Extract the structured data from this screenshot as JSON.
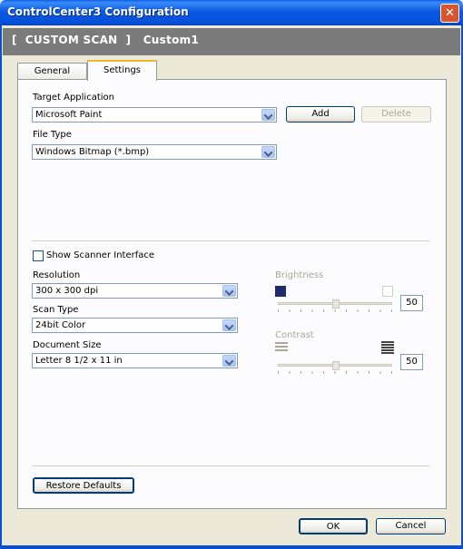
{
  "window": {
    "title": "ControlCenter3 Configuration",
    "close_glyph": "✕"
  },
  "header": {
    "text": "[  CUSTOM SCAN  ]   Custom1"
  },
  "tabs": [
    {
      "label": "General"
    },
    {
      "label": "Settings"
    }
  ],
  "target_app": {
    "label": "Target Application",
    "value": "Microsoft Paint",
    "add_label": "Add",
    "delete_label": "Delete"
  },
  "file_type": {
    "label": "File Type",
    "value": "Windows Bitmap (*.bmp)"
  },
  "show_scanner": {
    "label": "Show Scanner Interface",
    "checked": false
  },
  "resolution": {
    "label": "Resolution",
    "value": "300 x 300 dpi"
  },
  "scan_type": {
    "label": "Scan Type",
    "value": "24bit Color"
  },
  "document_size": {
    "label": "Document Size",
    "value": "Letter 8 1/2 x 11 in"
  },
  "brightness": {
    "label": "Brightness",
    "value": "50"
  },
  "contrast": {
    "label": "Contrast",
    "value": "50"
  },
  "buttons": {
    "restore": "Restore Defaults",
    "ok": "OK",
    "cancel": "Cancel"
  },
  "colors": {
    "titlebar": "#0a5ee8",
    "header": "#7b7b7b",
    "face": "#ece9d8",
    "tab_accent": "#f6b52e",
    "brightness_dark": "#1f2b6e"
  }
}
